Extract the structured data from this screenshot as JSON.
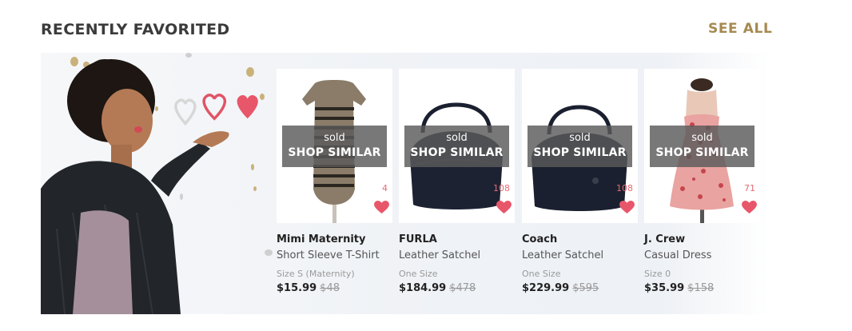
{
  "header": {
    "title": "RECENTLY FAVORITED",
    "see_all": "SEE ALL"
  },
  "colors": {
    "accent": "#a58a50",
    "heart": "#e8566a",
    "overlay": "#5a5a5a"
  },
  "products": [
    {
      "status": "sold",
      "cta": "SHOP SIMILAR",
      "favorites": "4",
      "brand": "Mimi Maternity",
      "name": "Short Sleeve T-Shirt",
      "size": "Size S (Maternity)",
      "price": "$15.99",
      "original_price": "$48"
    },
    {
      "status": "sold",
      "cta": "SHOP SIMILAR",
      "favorites": "108",
      "brand": "FURLA",
      "name": "Leather Satchel",
      "size": "One Size",
      "price": "$184.99",
      "original_price": "$478"
    },
    {
      "status": "sold",
      "cta": "SHOP SIMILAR",
      "favorites": "108",
      "brand": "Coach",
      "name": "Leather Satchel",
      "size": "One Size",
      "price": "$229.99",
      "original_price": "$595"
    },
    {
      "status": "sold",
      "cta": "SHOP SIMILAR",
      "favorites": "71",
      "brand": "J. Crew",
      "name": "Casual Dress",
      "size": "Size 0",
      "price": "$35.99",
      "original_price": "$158"
    }
  ]
}
